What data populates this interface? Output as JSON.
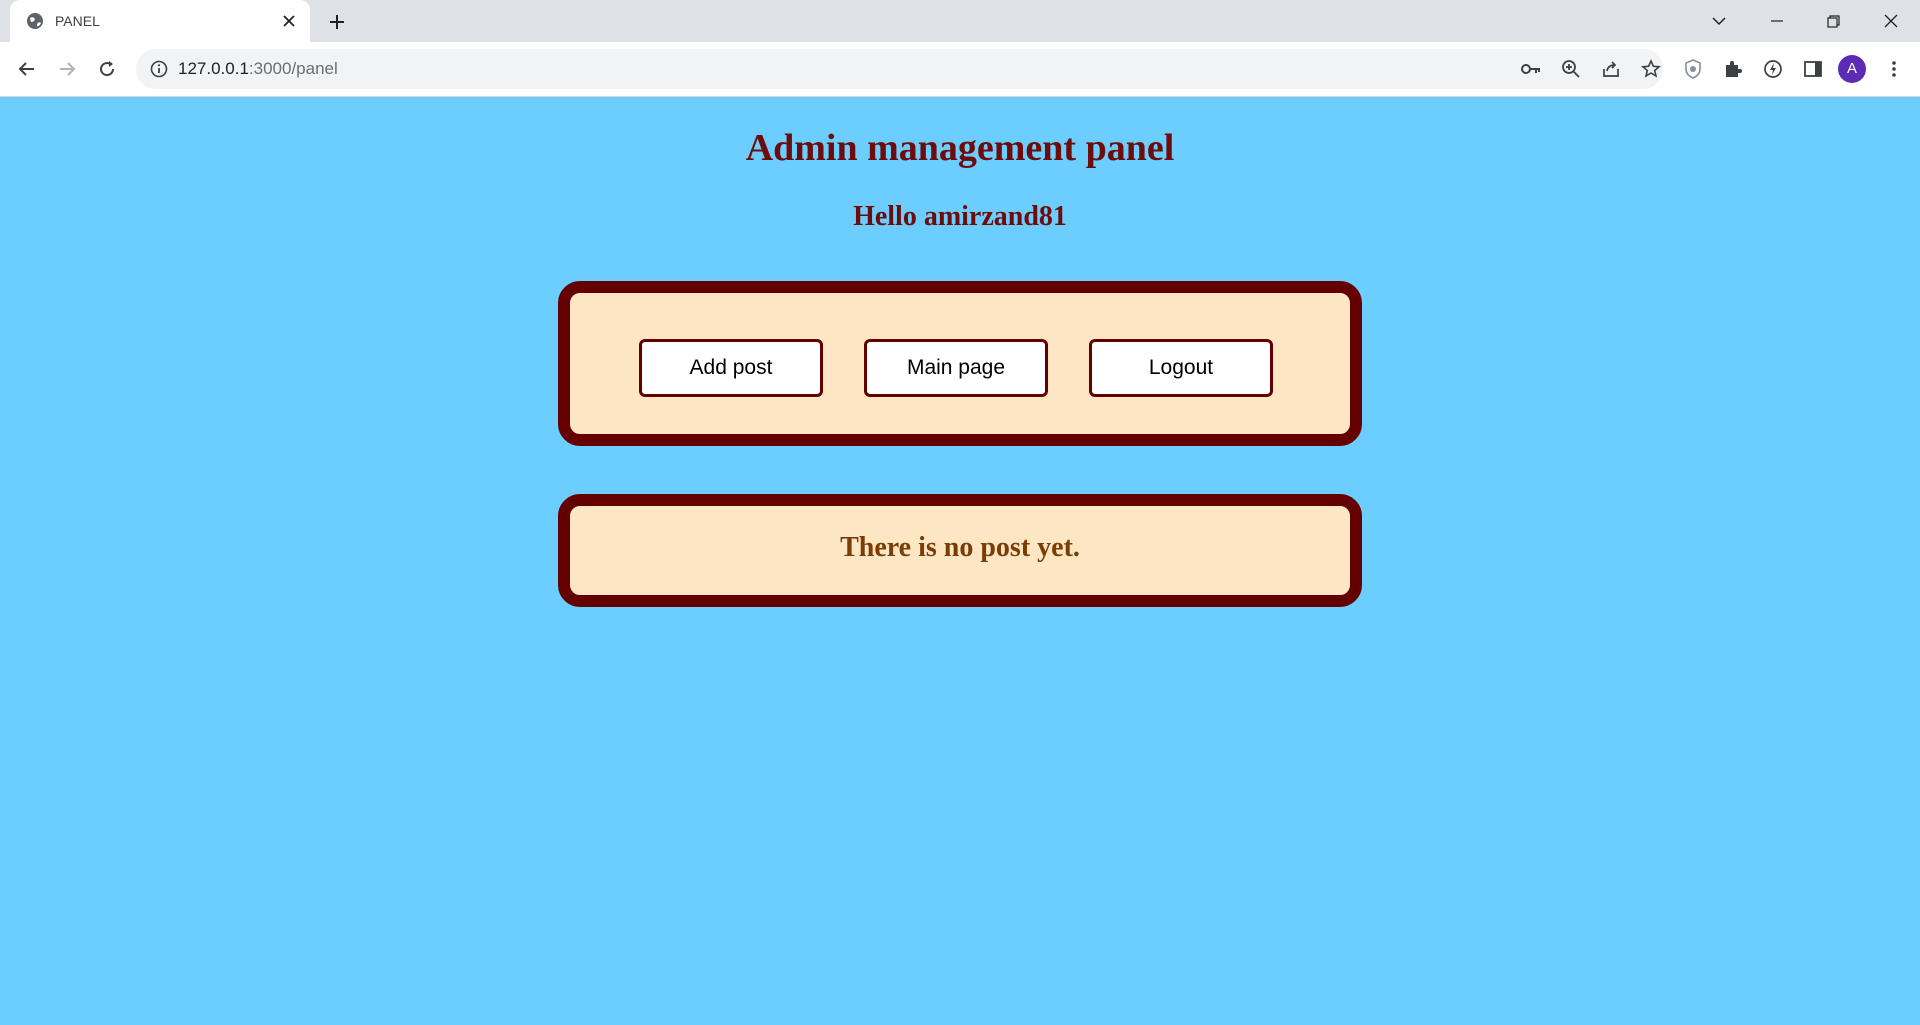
{
  "browser": {
    "tab": {
      "title": "PANEL"
    },
    "address": {
      "host": "127.0.0.1",
      "rest": ":3000/panel"
    },
    "profile_initial": "A"
  },
  "page": {
    "title": "Admin management panel",
    "greeting": "Hello amirzand81",
    "buttons": {
      "add_post": "Add post",
      "main_page": "Main page",
      "logout": "Logout"
    },
    "empty_message": "There is no post yet."
  },
  "colors": {
    "page_background": "#6ccdff",
    "heading": "#6e0b0b",
    "box_border": "#640000",
    "box_fill": "#fde6c4",
    "empty_text": "#7a3d06",
    "avatar": "#5b2bb6"
  }
}
